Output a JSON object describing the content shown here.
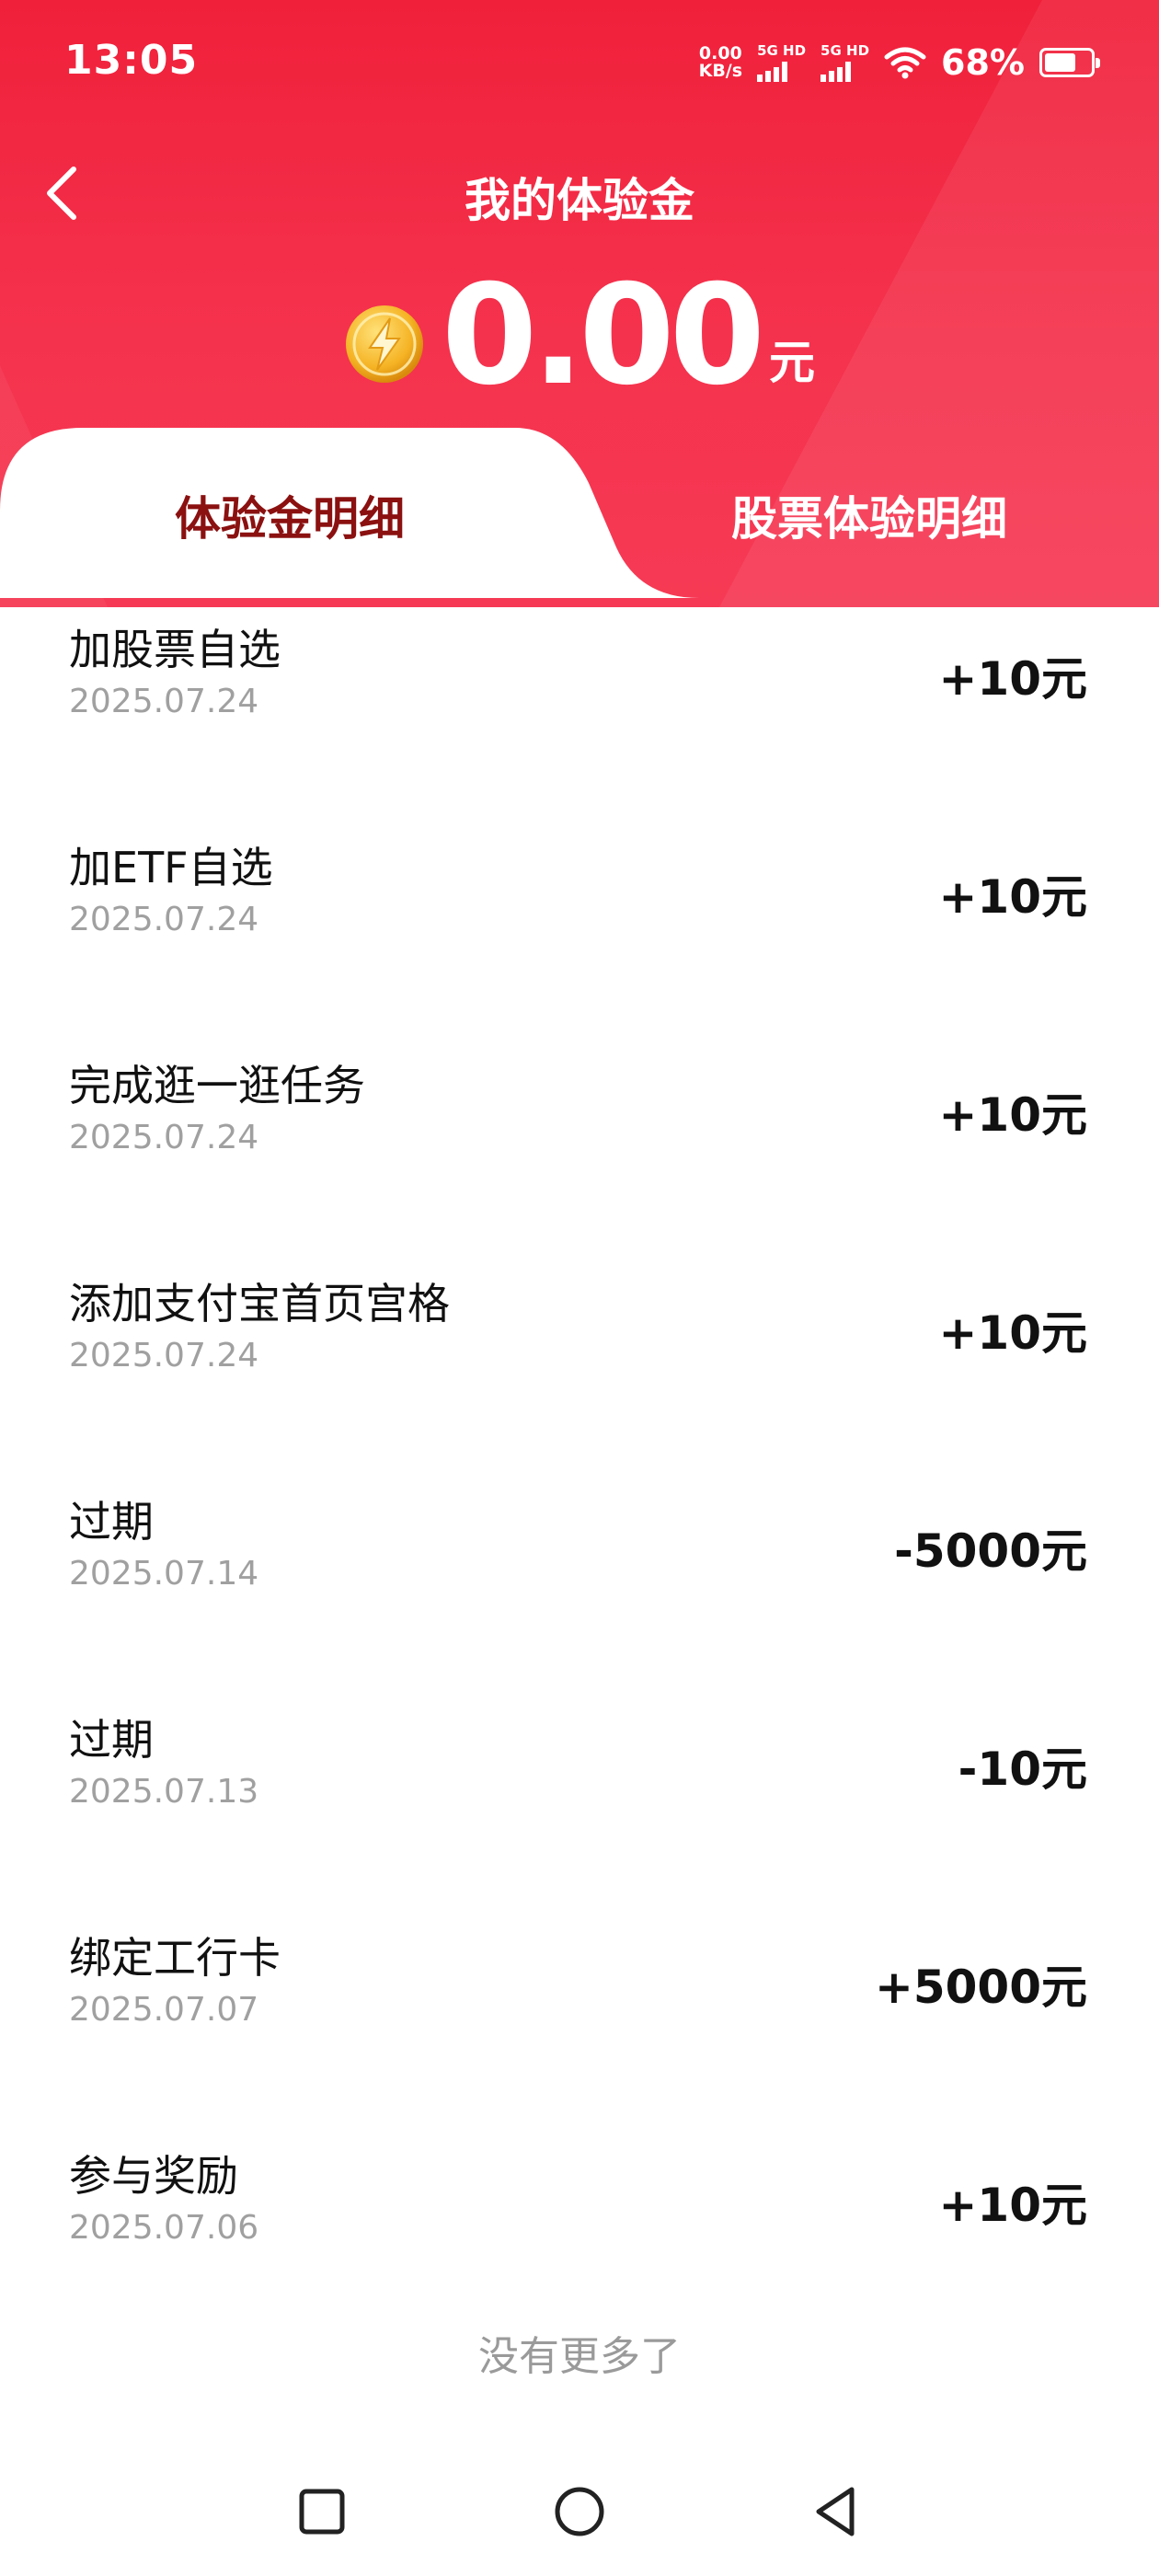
{
  "status": {
    "time": "13:05",
    "net_speed_value": "0.00",
    "net_speed_unit": "KB/s",
    "sim1_label": "5G HD",
    "sim2_label": "5G HD",
    "battery_percent": "68%",
    "battery_level": 0.68
  },
  "header": {
    "title": "我的体验金",
    "back_icon": "back-chevron-icon",
    "coin_icon": "lightning-coin-icon",
    "balance": "0.00",
    "balance_unit": "元"
  },
  "tabs": [
    {
      "label": "体验金明细",
      "active": true
    },
    {
      "label": "股票体验明细",
      "active": false
    }
  ],
  "records": [
    {
      "title": "加股票自选",
      "date": "2025.07.24",
      "amount": "+10元"
    },
    {
      "title": "加ETF自选",
      "date": "2025.07.24",
      "amount": "+10元"
    },
    {
      "title": "完成逛一逛任务",
      "date": "2025.07.24",
      "amount": "+10元"
    },
    {
      "title": "添加支付宝首页宫格",
      "date": "2025.07.24",
      "amount": "+10元"
    },
    {
      "title": "过期",
      "date": "2025.07.14",
      "amount": "-5000元"
    },
    {
      "title": "过期",
      "date": "2025.07.13",
      "amount": "-10元"
    },
    {
      "title": "绑定工行卡",
      "date": "2025.07.07",
      "amount": "+5000元"
    },
    {
      "title": "参与奖励",
      "date": "2025.07.06",
      "amount": "+10元"
    }
  ],
  "footer": {
    "no_more": "没有更多了"
  },
  "colors": {
    "header_red": "#f0203a",
    "active_tab_text": "#8b1010",
    "date_gray": "#a0a0a0"
  }
}
